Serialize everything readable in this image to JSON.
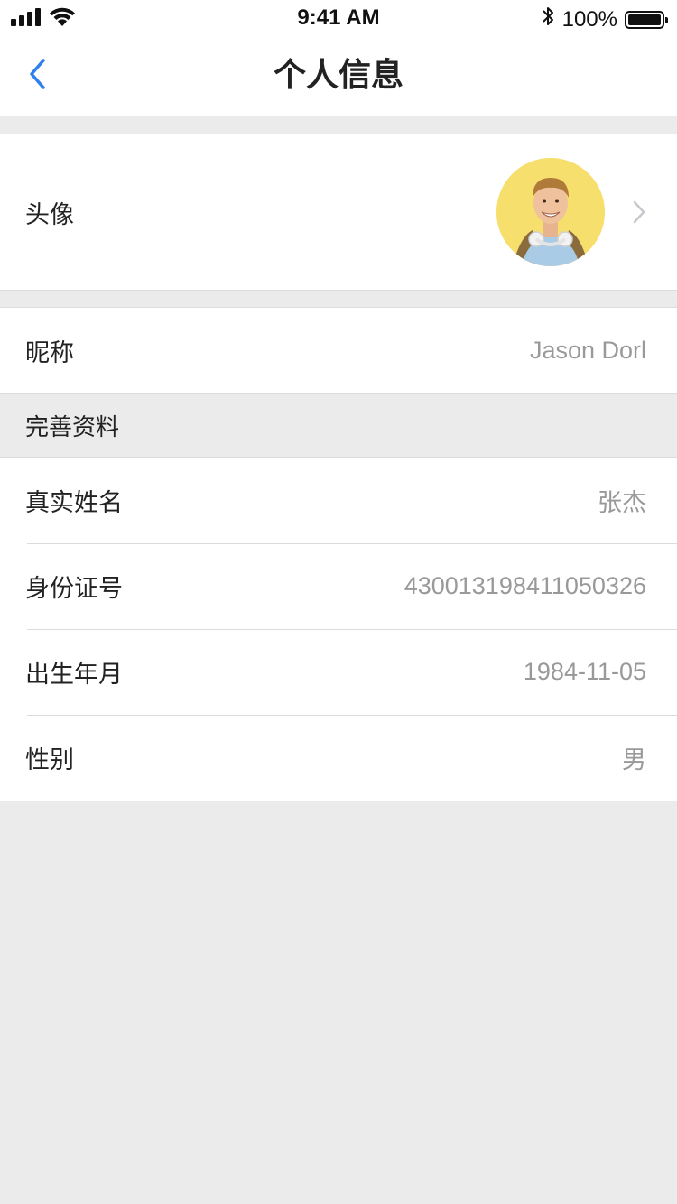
{
  "status_bar": {
    "time": "9:41 AM",
    "battery": "100%",
    "icons": [
      "signal-icon",
      "wifi-icon",
      "bluetooth-icon",
      "battery-icon"
    ]
  },
  "nav": {
    "title": "个人信息",
    "back_icon": "chevron-left-icon"
  },
  "avatar_row": {
    "label": "头像",
    "chevron_icon": "chevron-right-icon"
  },
  "nickname_row": {
    "label": "昵称",
    "value": "Jason Dorl"
  },
  "section": {
    "title": "完善资料"
  },
  "profile": {
    "items": [
      {
        "label": "真实姓名",
        "value": "张杰"
      },
      {
        "label": "身份证号",
        "value": "430013198411050326"
      },
      {
        "label": "出生年月",
        "value": "1984-11-05"
      },
      {
        "label": "性别",
        "value": "男"
      }
    ]
  },
  "colors": {
    "accent": "#2f80ed",
    "background": "#ebebeb",
    "value_text": "#999999",
    "label_text": "#222222",
    "avatar_bg": "#f7df6d"
  }
}
